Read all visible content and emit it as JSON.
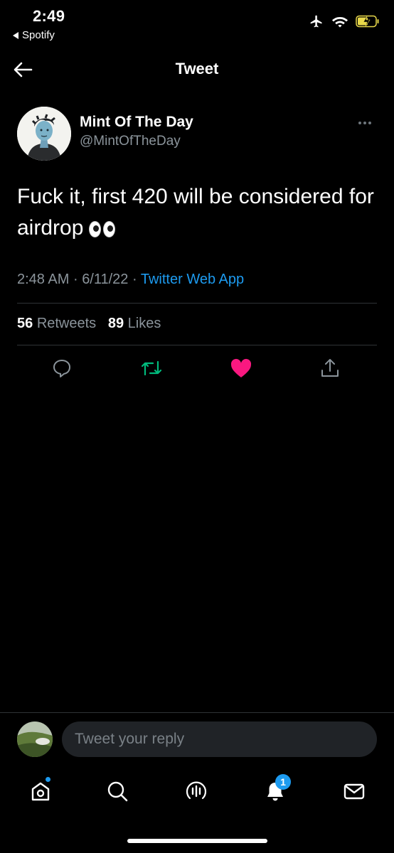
{
  "status_bar": {
    "time": "2:49",
    "back_app": "Spotify",
    "icons": [
      "airplane-icon",
      "wifi-icon",
      "battery-charging-icon"
    ]
  },
  "nav": {
    "title": "Tweet",
    "back_icon": "arrow-left-icon"
  },
  "tweet": {
    "author_name": "Mint Of The Day",
    "author_handle": "@MintOfTheDay",
    "text": "Fuck it, first 420 will be considered for airdrop",
    "emoji": "eyes-emoji",
    "time": "2:48 AM",
    "date": "6/11/22",
    "separator": "·",
    "app": "Twitter Web App",
    "retweets_count": "56",
    "retweets_label": "Retweets",
    "likes_count": "89",
    "likes_label": "Likes",
    "liked": true,
    "retweeted": true
  },
  "actions": [
    "reply-icon",
    "retweet-icon",
    "like-icon",
    "share-icon"
  ],
  "reply": {
    "placeholder": "Tweet your reply"
  },
  "tabbar": {
    "items": [
      "home-icon",
      "search-icon",
      "spaces-icon",
      "notifications-icon",
      "messages-icon"
    ],
    "notifications_badge": "1"
  },
  "colors": {
    "accent": "#1d9bf0",
    "retweet": "#00ba7c",
    "like": "#f91880",
    "muted": "#8b949b",
    "background": "#000000"
  }
}
